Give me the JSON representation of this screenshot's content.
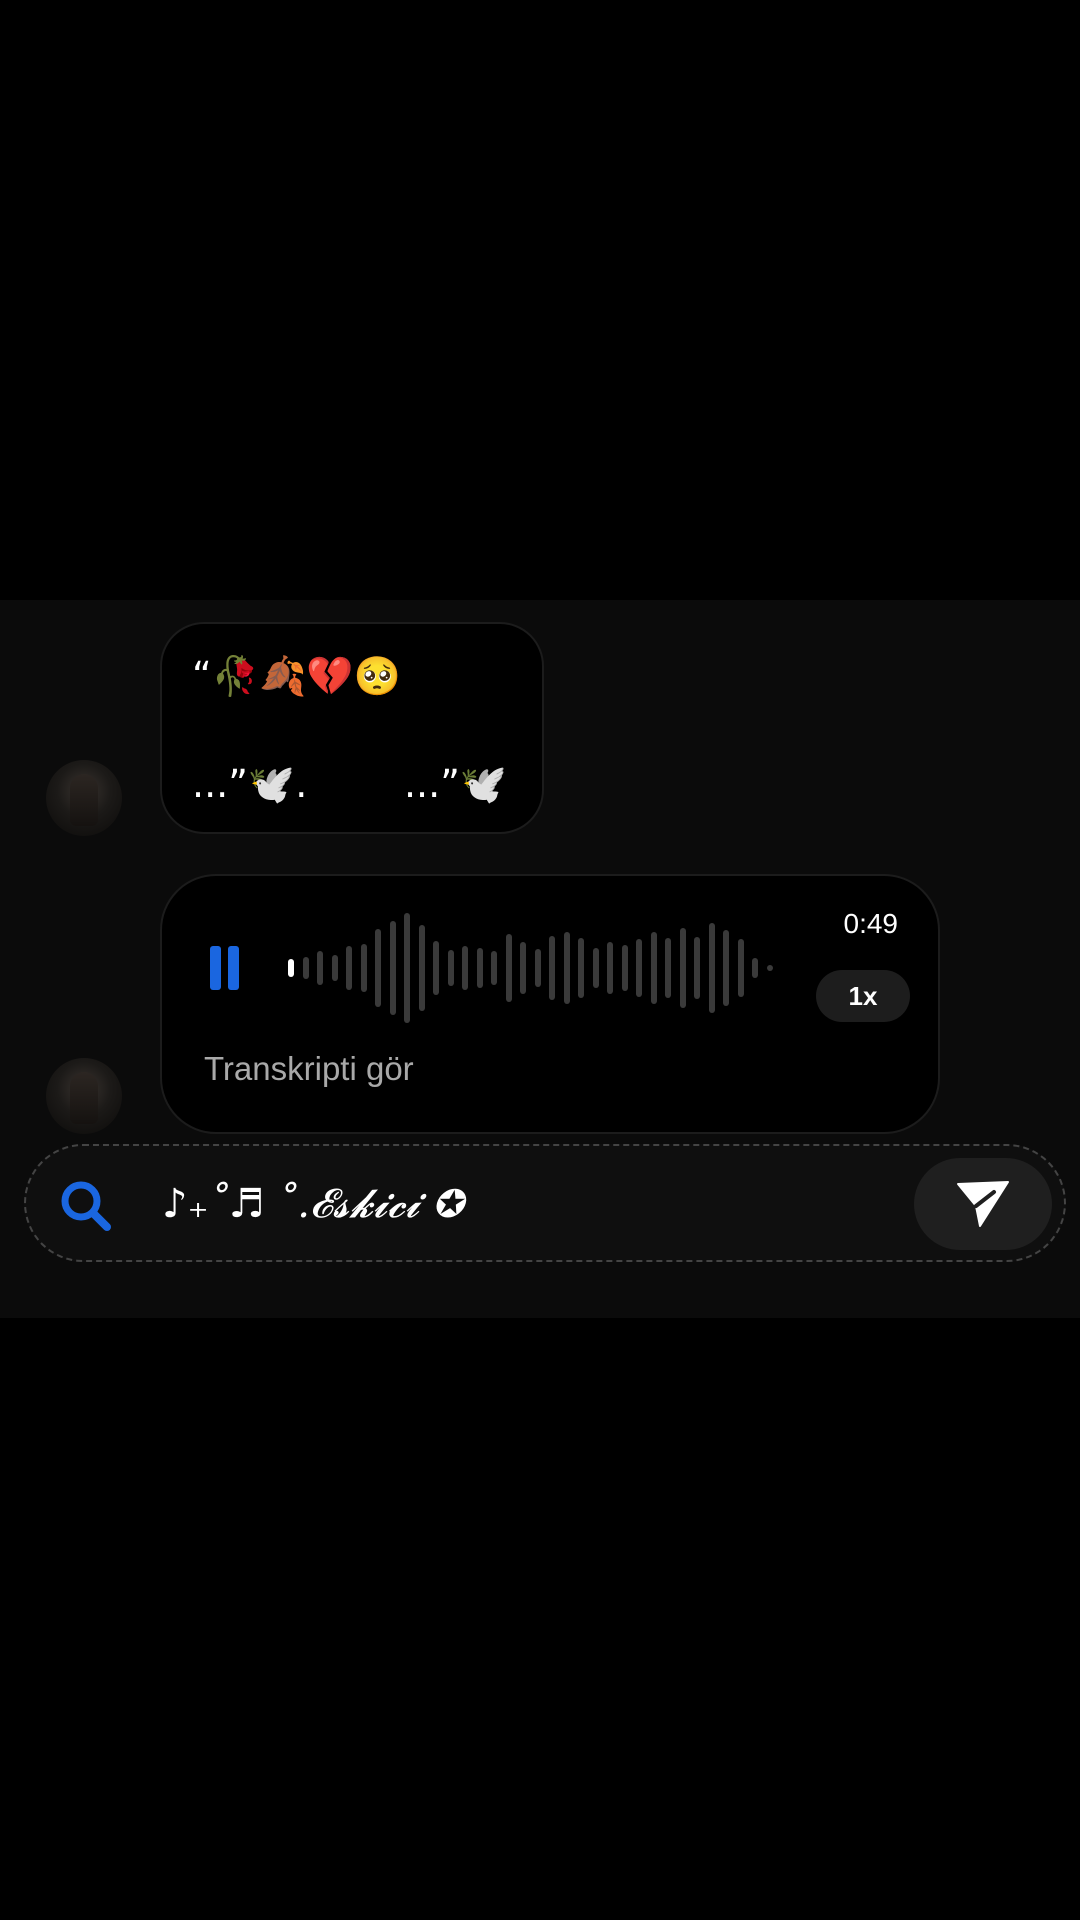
{
  "messages": {
    "text_bubble": {
      "line1": "“🥀🍂💔🥺",
      "line2": "...”🕊️.        ...”🕊️"
    },
    "voice_bubble": {
      "duration": "0:49",
      "speed": "1x",
      "transcript_link": "Transkripti gör",
      "progress": 0.0
    }
  },
  "composer": {
    "text": "♪₊˚♬ ˚.𝓔𝓼𝓴𝓲𝓬𝓲 ✪",
    "search_icon": "search-icon",
    "send_icon": "send-icon"
  },
  "colors": {
    "accent": "#1a66e0",
    "bubble_bg": "#000000",
    "panel_bg": "#0b0b0b"
  }
}
